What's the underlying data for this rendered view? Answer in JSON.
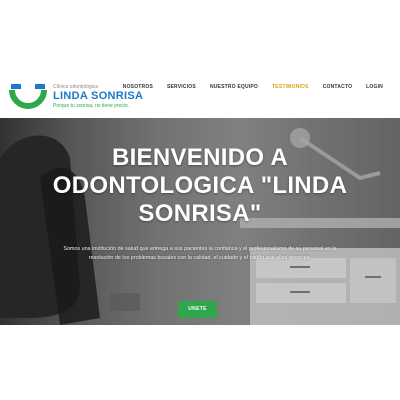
{
  "brand": {
    "small": "Clínica odontológica",
    "name": "LINDA SONRISA",
    "slogan": "Porque tu sonrisa, no tiene precio.",
    "colors": {
      "blue": "#1e78c8",
      "green": "#2ea84a"
    }
  },
  "nav": {
    "items": [
      {
        "label": "NOSOTROS"
      },
      {
        "label": "SERVICIOS"
      },
      {
        "label": "NUESTRO EQUIPO"
      },
      {
        "label": "TESTIMONIOS",
        "active": true
      },
      {
        "label": "CONTACTO"
      },
      {
        "label": "LOGIN"
      }
    ],
    "active_color": "#d9a21b"
  },
  "hero": {
    "title": "BIENVENIDO A ODONTOLOGICA \"LINDA SONRISA\"",
    "text": "Somos una institución de salud que entrega a sus pacientes la confianza y el profesionalismo de su personal en la resolución de los problemas bucales con la calidad, el cuidado y el cariño que ellos merecen.",
    "button": "UNETE",
    "button_color": "#2ea84a"
  }
}
